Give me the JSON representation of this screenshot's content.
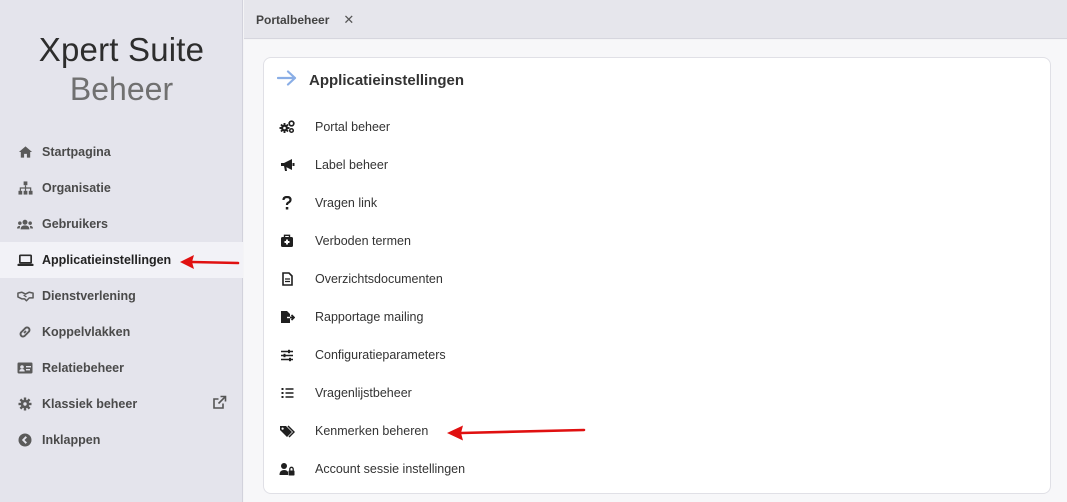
{
  "brand": {
    "title": "Xpert Suite",
    "subtitle": "Beheer"
  },
  "sidebar": {
    "items": [
      {
        "label": "Startpagina",
        "icon": "home-icon"
      },
      {
        "label": "Organisatie",
        "icon": "sitemap-icon"
      },
      {
        "label": "Gebruikers",
        "icon": "users-icon"
      },
      {
        "label": "Applicatieinstellingen",
        "icon": "laptop-icon",
        "active": true
      },
      {
        "label": "Dienstverlening",
        "icon": "handshake-icon"
      },
      {
        "label": "Koppelvlakken",
        "icon": "link-icon"
      },
      {
        "label": "Relatiebeheer",
        "icon": "id-card-icon"
      },
      {
        "label": "Klassiek beheer",
        "icon": "gear-icon"
      },
      {
        "label": "Inklappen",
        "icon": "chevron-circle-left-icon"
      }
    ]
  },
  "tabs": [
    {
      "label": "Portalbeheer",
      "close": "✕"
    }
  ],
  "card": {
    "title": "Applicatieinstellingen",
    "items": [
      {
        "label": "Portal beheer",
        "icon": "cogs-icon"
      },
      {
        "label": "Label beheer",
        "icon": "megaphone-icon"
      },
      {
        "label": "Vragen link",
        "icon": "question-icon"
      },
      {
        "label": "Verboden termen",
        "icon": "medkit-icon"
      },
      {
        "label": "Overzichtsdocumenten",
        "icon": "file-text-icon"
      },
      {
        "label": "Rapportage mailing",
        "icon": "file-export-icon"
      },
      {
        "label": "Configuratieparameters",
        "icon": "sliders-icon"
      },
      {
        "label": "Vragenlijstbeheer",
        "icon": "list-icon"
      },
      {
        "label": "Kenmerken beheren",
        "icon": "tags-icon"
      },
      {
        "label": "Account sessie instellingen",
        "icon": "user-lock-icon"
      }
    ]
  },
  "colors": {
    "accent_arrow": "#8aaee6",
    "annotation": "#e01010",
    "sidebar_bg": "#e4e4ec"
  }
}
